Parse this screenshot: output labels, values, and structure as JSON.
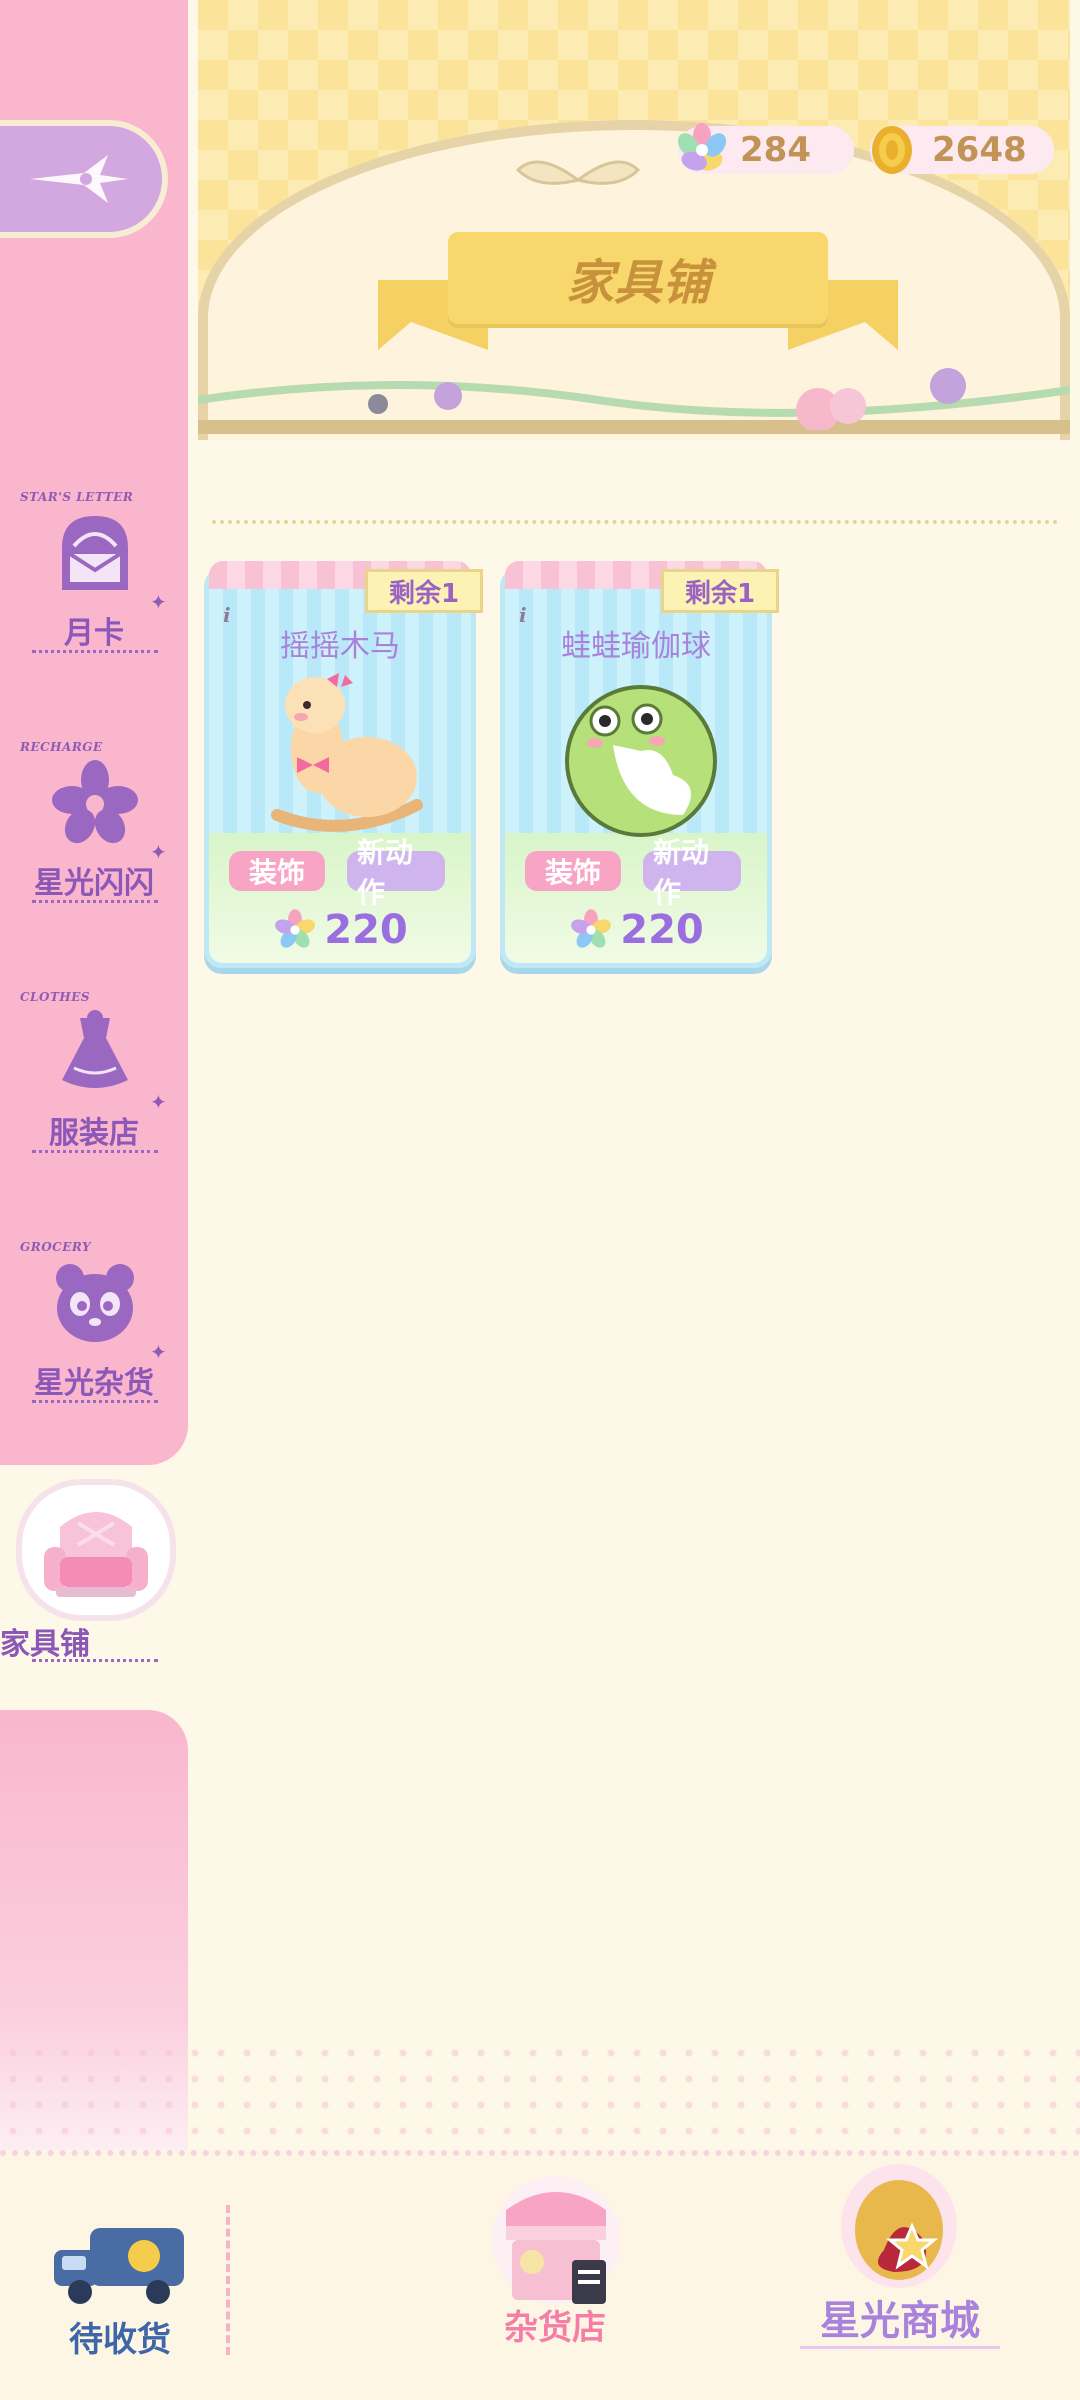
{
  "currencies": [
    {
      "name": "star-gem",
      "value": "284"
    },
    {
      "name": "gold-coin",
      "value": "2648"
    }
  ],
  "header": {
    "title": "家具铺"
  },
  "sidebar": {
    "items": [
      {
        "tag": "STAR'S LETTER",
        "label": "月卡",
        "icon": "letter-icon"
      },
      {
        "tag": "RECHARGE",
        "label": "星光闪闪",
        "icon": "flower-icon"
      },
      {
        "tag": "CLOTHES",
        "label": "服装店",
        "icon": "dress-icon"
      },
      {
        "tag": "GROCERY",
        "label": "星光杂货",
        "icon": "panda-icon"
      },
      {
        "tag": "",
        "label": "家具铺",
        "icon": "sofa-icon",
        "active": true
      }
    ]
  },
  "products": [
    {
      "name": "摇摇木马",
      "remaining": "剩余1",
      "tags": [
        "装饰",
        "新动作"
      ],
      "price": "220",
      "icon": "rocking-alpaca-icon"
    },
    {
      "name": "蛙蛙瑜伽球",
      "remaining": "剩余1",
      "tags": [
        "装饰",
        "新动作"
      ],
      "price": "220",
      "icon": "frog-yoga-ball-icon"
    }
  ],
  "bottom_bar": {
    "pending": "待收货",
    "grocery": "杂货店",
    "starlight_mall": "星光商城"
  },
  "colors": {
    "sidebar": "#f9b6cd",
    "accent_purple": "#9a6ee0",
    "banner_gold": "#fbe49a",
    "background": "#fef8e8"
  }
}
